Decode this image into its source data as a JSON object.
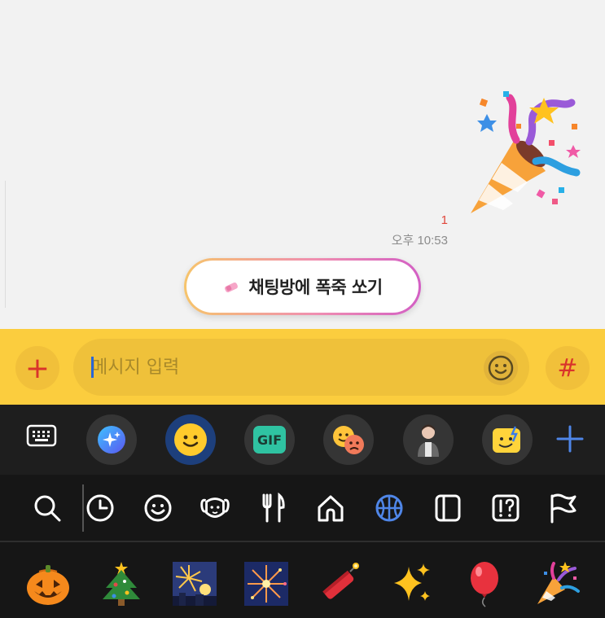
{
  "chat": {
    "sticker_icon": "party-popper",
    "unread_count": "1",
    "time": "오후 10:53",
    "firework_button": {
      "label": "채팅방에 폭죽 쏘기",
      "icon": "firecracker-icon"
    }
  },
  "input_bar": {
    "placeholder": "메시지 입력",
    "value": "",
    "plus_icon": "+",
    "hash_icon": "#"
  },
  "sticker_tabs": [
    {
      "name": "keyboard"
    },
    {
      "name": "ai-sparkle"
    },
    {
      "name": "emoticon",
      "selected": true
    },
    {
      "name": "gif",
      "label": "GIF"
    },
    {
      "name": "mood-faces"
    },
    {
      "name": "avatar"
    },
    {
      "name": "sticker-face"
    },
    {
      "name": "add"
    }
  ],
  "categories": [
    "search",
    "recent",
    "smileys",
    "animals",
    "food",
    "places",
    "activities",
    "objects",
    "symbols",
    "flags"
  ],
  "selected_category": "activities",
  "emojis": [
    "jack-o-lantern",
    "christmas-tree",
    "fireworks-city",
    "fireworks",
    "firecracker",
    "sparkles",
    "balloon",
    "party-popper"
  ],
  "colors": {
    "input_bar": "#fbcd3e",
    "accent_blue": "#4f86e8",
    "plus_red": "#d9342b",
    "dark_bg": "#161616"
  }
}
